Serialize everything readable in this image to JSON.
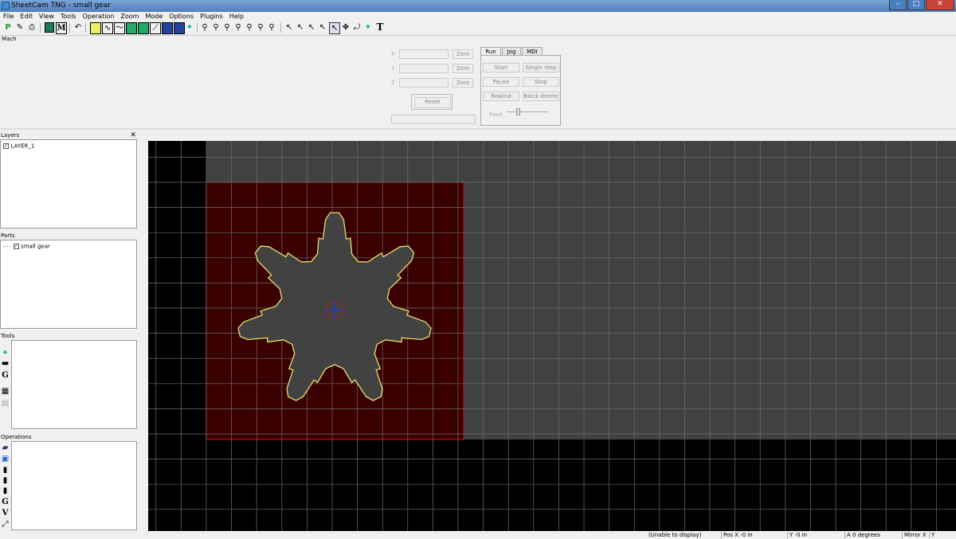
{
  "window": {
    "title": "SheetCam TNG - small gear",
    "minimize": "–",
    "maximize": "□",
    "close": "✕"
  },
  "menu": [
    "File",
    "Edit",
    "View",
    "Tools",
    "Operation",
    "Zoom",
    "Mode",
    "Options",
    "Plugins",
    "Help"
  ],
  "mach": {
    "label": "Mach",
    "axes": [
      {
        "label": "X",
        "zero": "Zero"
      },
      {
        "label": "Y",
        "zero": "Zero"
      },
      {
        "label": "Z",
        "zero": "Zero"
      }
    ],
    "reset": "Reset",
    "tabs": [
      "Run",
      "Jog",
      "MDI"
    ],
    "buttons": {
      "start": "Start",
      "single_step": "Single step",
      "pause": "Pause",
      "stop": "Stop",
      "rewind": "Rewind",
      "block_delete": "Block delete"
    },
    "feed_label": "Feed"
  },
  "layers": {
    "title": "Layers",
    "items": [
      {
        "label": "LAYER_1",
        "checked": true
      }
    ]
  },
  "parts": {
    "title": "Parts",
    "items": [
      {
        "label": "small gear",
        "checked": true
      }
    ]
  },
  "tools": {
    "title": "Tools",
    "icons": [
      "plasma-icon",
      "drill-icon",
      "g-icon",
      "grid-icon",
      "sheet-icon"
    ]
  },
  "operations": {
    "title": "Operations",
    "icons": [
      "monitor-icon",
      "cut-icon",
      "tool-change-icon",
      "drill-icon",
      "tool-icon",
      "g-icon",
      "v-icon",
      "arrow-icon"
    ]
  },
  "status": {
    "message": "(Unable to display)",
    "pos_x": "Pos X  -0 in",
    "y": "Y  -0 in",
    "a": "A  0 degrees",
    "mirror_x": "Mirror X",
    "y_flag": "Y"
  },
  "colors": {
    "canvas_bg": "#000000",
    "material": "#414141",
    "part_fill": "#3a0000",
    "part_border": "#c21c1c",
    "gear_fill": "#424242",
    "gear_outline": "#e6e26a",
    "grid": "#6e6e6e",
    "origin": "#2a36c8"
  }
}
